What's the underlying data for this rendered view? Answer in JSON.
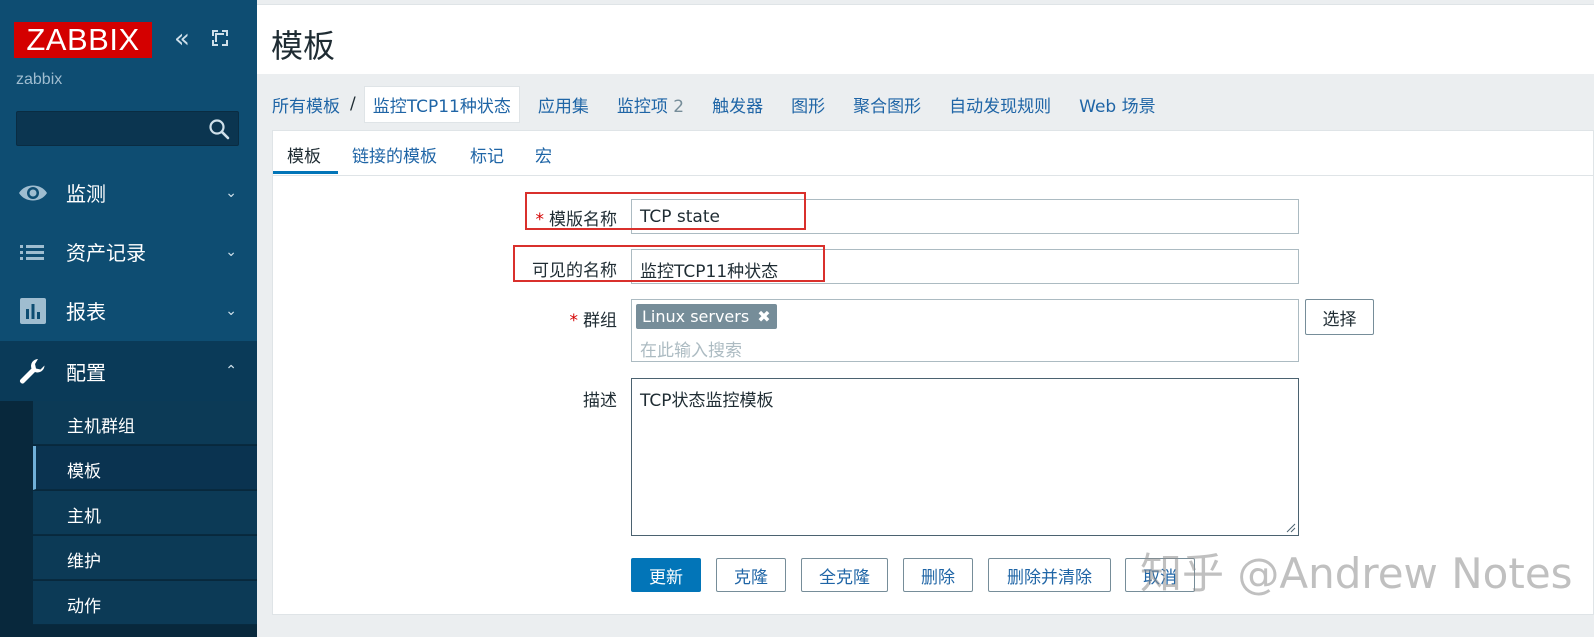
{
  "sidebar": {
    "logo": "ZABBIX",
    "server_name": "zabbix",
    "search_value": "",
    "menu": [
      {
        "label": "监测",
        "icon": "eye-icon"
      },
      {
        "label": "资产记录",
        "icon": "list-icon"
      },
      {
        "label": "报表",
        "icon": "bar-chart-icon"
      },
      {
        "label": "配置",
        "icon": "wrench-icon"
      }
    ],
    "submenu": [
      {
        "label": "主机群组"
      },
      {
        "label": "模板"
      },
      {
        "label": "主机"
      },
      {
        "label": "维护"
      },
      {
        "label": "动作"
      }
    ]
  },
  "header": {
    "title": "模板"
  },
  "nav": {
    "root": "所有模板",
    "separator": "/",
    "current": "监控TCP11种状态",
    "links": [
      "应用集",
      "监控项",
      "触发器",
      "图形",
      "聚合图形",
      "自动发现规则",
      "Web 场景"
    ],
    "items_badge": "2"
  },
  "tabs": [
    "模板",
    "链接的模板",
    "标记",
    "宏"
  ],
  "form": {
    "template_name_label": "模版名称",
    "template_name_value": "TCP state",
    "visible_name_label": "可见的名称",
    "visible_name_value": "监控TCP11种状态",
    "groups_label": "群组",
    "group_chip": "Linux servers",
    "group_chip_remove": "✖",
    "groups_placeholder": "在此输入搜索",
    "select_label": "选择",
    "description_label": "描述",
    "description_value": "TCP状态监控模板",
    "required_mark": "*"
  },
  "buttons": {
    "update": "更新",
    "clone": "克隆",
    "full_clone": "全克隆",
    "delete": "删除",
    "delete_clear": "删除并清除",
    "cancel": "取消"
  },
  "watermark": "知乎 @Andrew Notes",
  "colors": {
    "sidebar_bg": "#0e4d72",
    "logo_red": "#d40000",
    "link_blue": "#1f65a6",
    "primary_button": "#0275b8",
    "highlight_red": "#d9302c"
  }
}
